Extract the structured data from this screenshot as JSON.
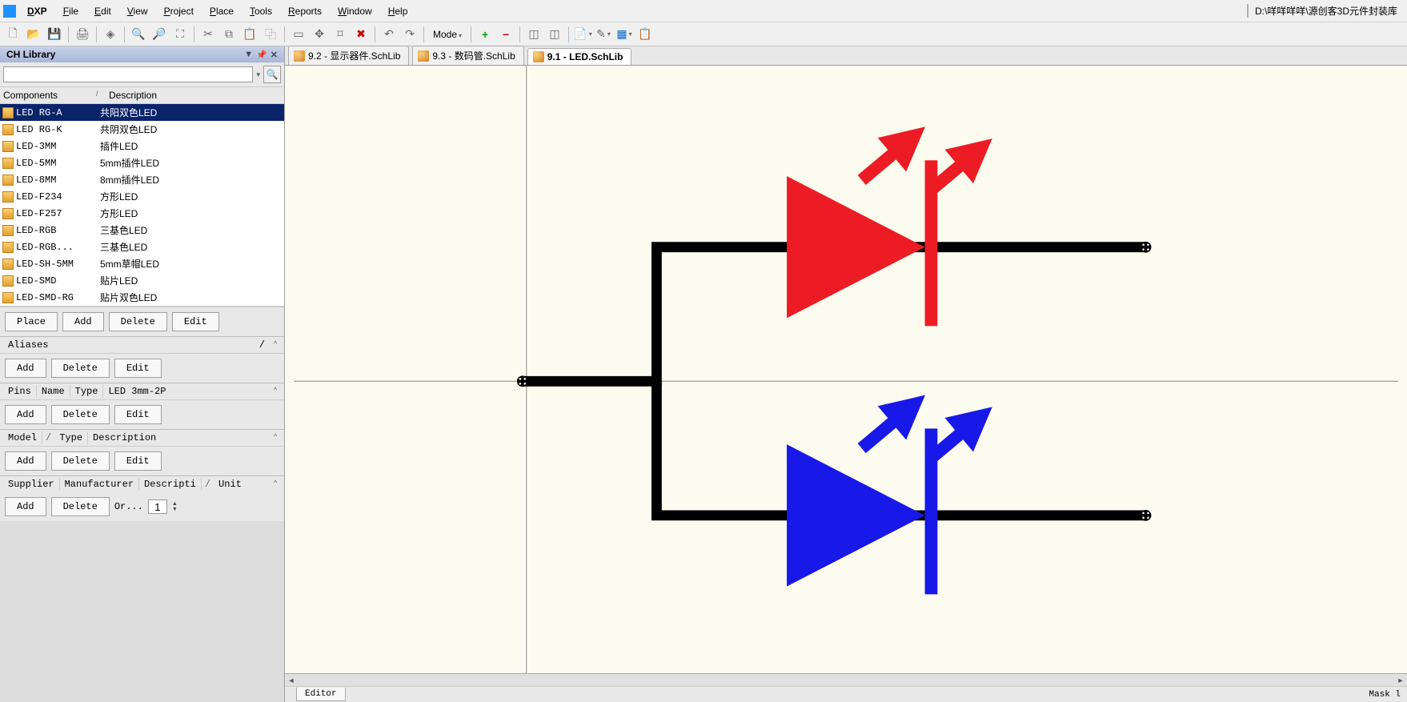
{
  "app": {
    "brand": "DXP"
  },
  "menu": [
    "File",
    "Edit",
    "View",
    "Project",
    "Place",
    "Tools",
    "Reports",
    "Window",
    "Help"
  ],
  "path_bar": "D:\\咩咩咩咩\\源创客3D元件封装库",
  "toolbar": {
    "mode_label": "Mode"
  },
  "panel": {
    "title": "CH Library",
    "headers": {
      "components": "Components",
      "description": "Description"
    },
    "components_sort_glyph": "/",
    "components": [
      {
        "name": "LED RG-A",
        "desc": "共阳双色LED",
        "selected": true
      },
      {
        "name": "LED RG-K",
        "desc": "共阴双色LED"
      },
      {
        "name": "LED-3MM",
        "desc": "插件LED"
      },
      {
        "name": "LED-5MM",
        "desc": "5mm插件LED"
      },
      {
        "name": "LED-8MM",
        "desc": "8mm插件LED"
      },
      {
        "name": "LED-F234",
        "desc": "方形LED"
      },
      {
        "name": "LED-F257",
        "desc": "方形LED"
      },
      {
        "name": "LED-RGB",
        "desc": "三基色LED"
      },
      {
        "name": "LED-RGB...",
        "desc": "三基色LED"
      },
      {
        "name": "LED-SH-5MM",
        "desc": "5mm草帽LED"
      },
      {
        "name": "LED-SMD",
        "desc": "贴片LED"
      },
      {
        "name": "LED-SMD-RG",
        "desc": "贴片双色LED"
      }
    ],
    "buttons": {
      "place": "Place",
      "add": "Add",
      "delete": "Delete",
      "edit": "Edit"
    },
    "aliases_header": "Aliases",
    "pins_headers": {
      "pins": "Pins",
      "name": "Name",
      "type": "Type",
      "designator": "LED 3mm-2P"
    },
    "model_headers": {
      "model": "Model",
      "type": "Type",
      "desc": "Description"
    },
    "supplier_headers": {
      "supplier": "Supplier",
      "manufacturer": "Manufacturer",
      "descripti": "Descripti",
      "unit": "Unit"
    },
    "ordering_label": "Or...",
    "ordering_value": "1"
  },
  "tabs": [
    {
      "label": "9.2  - 显示器件.SchLib"
    },
    {
      "label": "9.3  - 数码管.SchLib"
    },
    {
      "label": "9.1  - LED.SchLib",
      "active": true
    }
  ],
  "editor_tab": "Editor",
  "status_mask": "Mask l",
  "colors": {
    "led1": "#ed1c24",
    "led2": "#1818e8",
    "wire": "#000000",
    "canvas": "#fcfbef"
  }
}
